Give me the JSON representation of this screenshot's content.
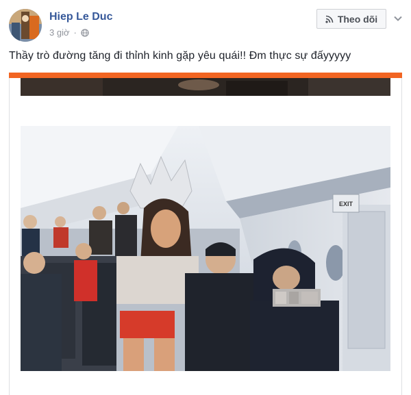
{
  "post": {
    "author": "Hiep Le Duc",
    "time": "3 giờ",
    "text": "Thầy trò đường tăng đi thỉnh kinh gặp yêu quái!! Đm thực sự đấyyyyy",
    "follow_label": "Theo dõi"
  },
  "photo": {
    "exit_sign": "EXIT"
  },
  "colors": {
    "author_link": "#365899",
    "accent_bar": "#f26522",
    "meta_gray": "#90949c"
  },
  "icons": {
    "privacy": "globe-icon",
    "follow": "rss-icon",
    "more": "chevron-down-icon"
  }
}
